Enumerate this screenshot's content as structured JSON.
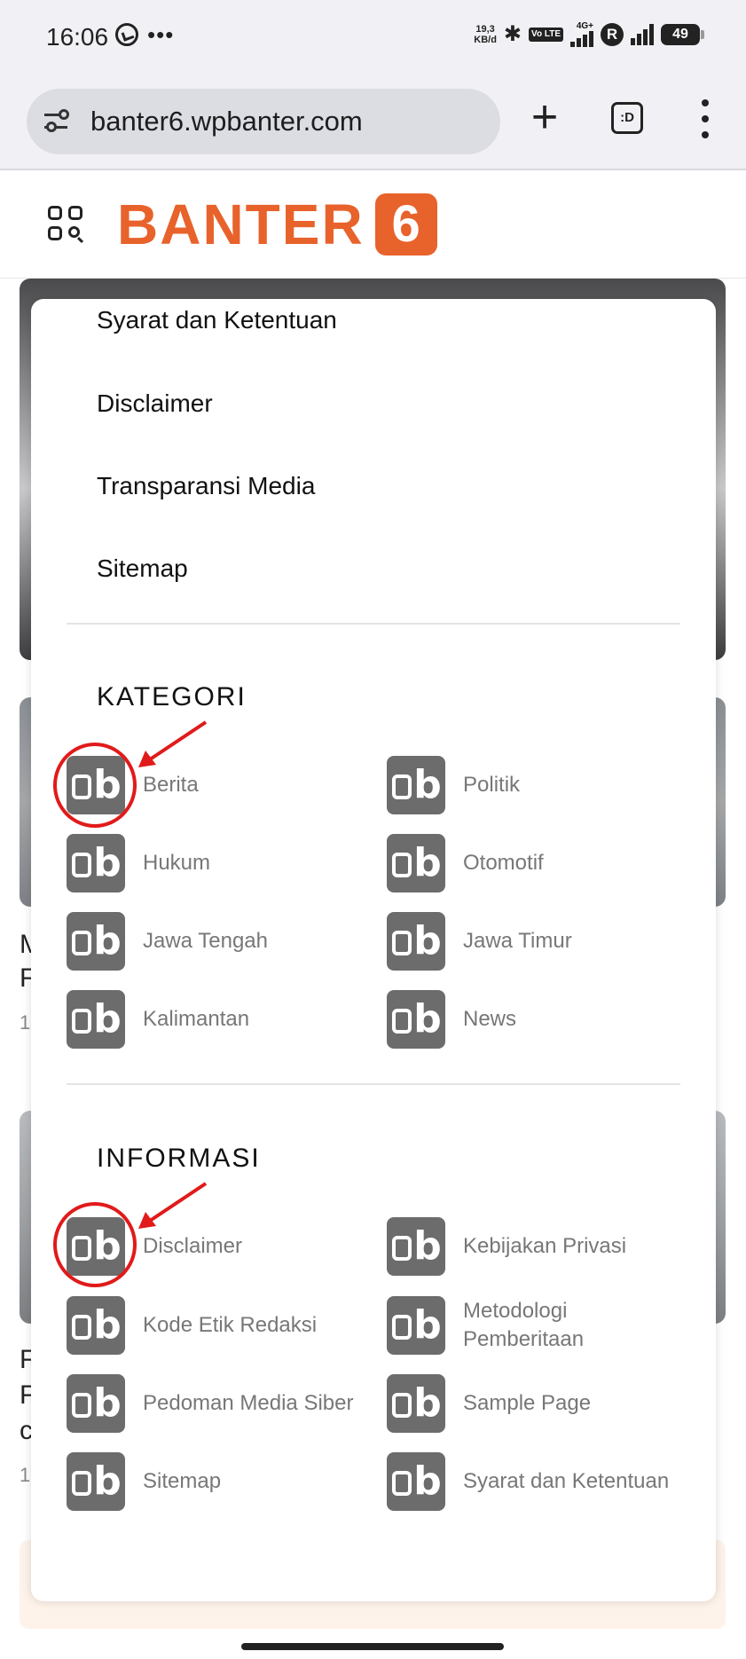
{
  "status_bar": {
    "time": "16:06",
    "speed_top": "19,3",
    "speed_bottom": "KB/d",
    "volte": "Vo LTE",
    "net_4g": "4G+",
    "r_badge": "R",
    "battery": "49"
  },
  "browser": {
    "url": "banter6.wpbanter.com",
    "tabs_label": ":D"
  },
  "site": {
    "logo_text": "BANTER",
    "logo_badge": "6"
  },
  "menu": {
    "links": [
      "Syarat dan Ketentuan",
      "Disclaimer",
      "Transparansi Media",
      "Sitemap"
    ],
    "kategori_title": "KATEGORI",
    "kategori": [
      "Berita",
      "Politik",
      "Hukum",
      "Otomotif",
      "Jawa Tengah",
      "Jawa Timur",
      "Kalimantan",
      "News"
    ],
    "informasi_title": "INFORMASI",
    "informasi": [
      "Disclaimer",
      "Kebijakan Privasi",
      "Kode Etik Redaksi",
      "Metodologi Pemberitaan",
      "Pedoman Media Siber",
      "Sample Page",
      "Sitemap",
      "Syarat dan Ketentuan"
    ]
  },
  "background": {
    "letters_a": [
      "M",
      "F",
      "1"
    ],
    "letters_b": [
      "F",
      "F",
      "c",
      "1"
    ]
  },
  "colors": {
    "brand": "#e8622b",
    "icon_bg": "#6c6c6c",
    "annotation": "#e11a1a"
  },
  "icons": {
    "category_icon": "ob-icon"
  }
}
